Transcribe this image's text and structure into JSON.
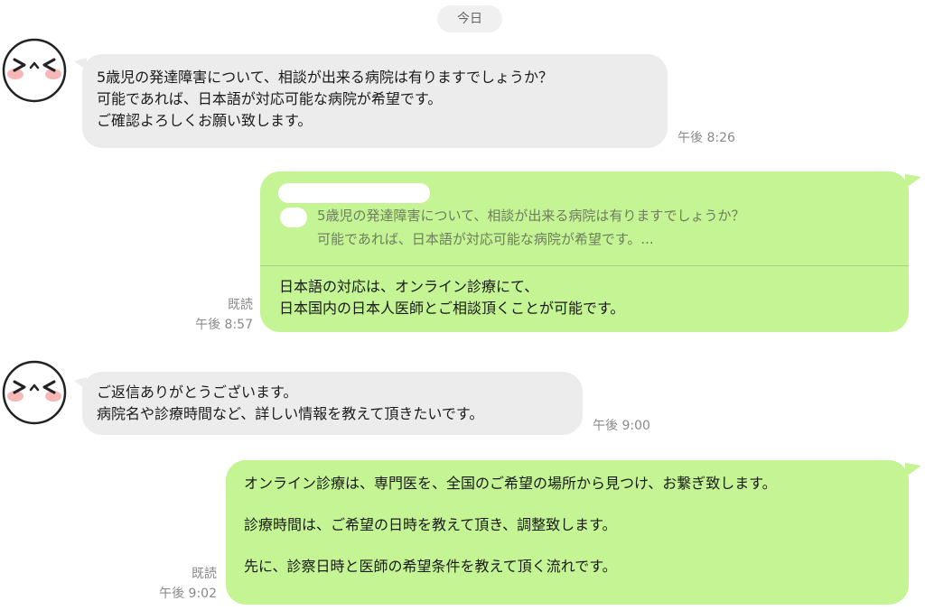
{
  "date_label": "今日",
  "messages": [
    {
      "direction": "in",
      "lines": [
        "5歳児の発達障害について、相談が出来る病院は有りますでしょうか？",
        "可能であれば、日本語が対応可能な病院が希望です。",
        "ご確認よろしくお願い致します。"
      ],
      "time": "午後 8:26"
    },
    {
      "direction": "out",
      "quote_lines": [
        "5歳児の発達障害について、相談が出来る病院は有りますでしょうか？",
        "可能であれば、日本語が対応可能な病院が希望です。..."
      ],
      "lines": [
        "日本語の対応は、オンライン診療にて、",
        "日本国内の日本人医師とご相談頂くことが可能です。"
      ],
      "read": "既読",
      "time": "午後 8:57"
    },
    {
      "direction": "in",
      "lines": [
        "ご返信ありがとうございます。",
        "病院名や診療時間など、詳しい情報を教えて頂きたいです。"
      ],
      "time": "午後 9:00"
    },
    {
      "direction": "out",
      "paragraphs": [
        "オンライン診療は、専門医を、全国のご希望の場所から見つけ、お繋ぎ致します。",
        "診療時間は、ご希望の日時を教えて頂き、調整致します。",
        "先に、診察日時と医師の希望条件を教えて頂く流れです。"
      ],
      "read": "既読",
      "time": "午後 9:02"
    }
  ],
  "colors": {
    "incoming_bubble": "#ececec",
    "outgoing_bubble": "#c4f493",
    "meta_text": "#8a8a8a"
  },
  "icons": {
    "avatar": "squinting-smiley-face-icon"
  }
}
